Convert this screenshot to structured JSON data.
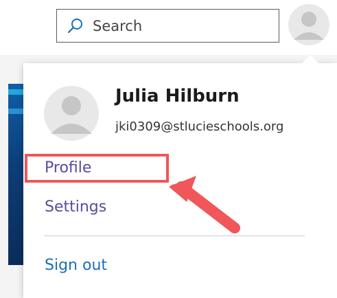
{
  "header": {
    "search": {
      "placeholder": "Search",
      "icon": "search-icon"
    },
    "avatar_icon": "person-avatar-icon"
  },
  "account_menu": {
    "user_name": "Julia Hilburn",
    "email": "jki0309@stlucieschools.org",
    "avatar_icon": "person-avatar-icon",
    "items": [
      {
        "label": "Profile",
        "highlighted": true
      },
      {
        "label": "Settings"
      },
      {
        "label": "Sign out"
      }
    ]
  },
  "annotation": {
    "color": "#f0565a",
    "target": "Profile",
    "arrow_icon": "pointer-arrow-icon"
  },
  "colors": {
    "link_purple": "#5b4a9e",
    "link_blue": "#1a6eb8",
    "avatar_gray": "#c6c6c6"
  }
}
